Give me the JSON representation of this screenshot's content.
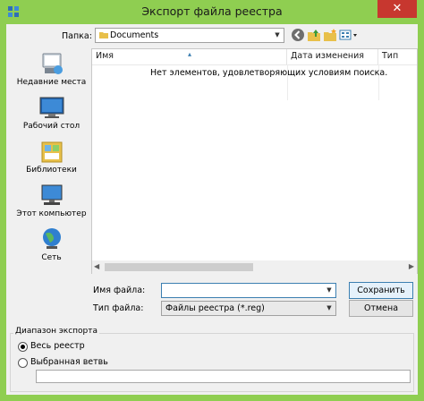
{
  "window": {
    "title": "Экспорт файла реестра",
    "close_glyph": "✕",
    "accent_color": "#8fce51"
  },
  "lookin": {
    "label": "Папка:",
    "value": "Documents"
  },
  "toolbar": {
    "icons": [
      "back-icon",
      "up-folder-icon",
      "new-folder-icon",
      "view-menu-icon"
    ]
  },
  "places": [
    {
      "label": "Недавние места",
      "icon": "recent-places-icon"
    },
    {
      "label": "Рабочий стол",
      "icon": "desktop-icon"
    },
    {
      "label": "Библиотеки",
      "icon": "libraries-icon"
    },
    {
      "label": "Этот компьютер",
      "icon": "computer-icon"
    },
    {
      "label": "Сеть",
      "icon": "network-icon"
    }
  ],
  "filelist": {
    "columns": [
      "Имя",
      "Дата изменения",
      "Тип"
    ],
    "empty_message": "Нет элементов, удовлетворяющих условиям поиска."
  },
  "filename": {
    "label": "Имя файла:",
    "value": ""
  },
  "filetype": {
    "label": "Тип файла:",
    "value": "Файлы реестра (*.reg)"
  },
  "buttons": {
    "save": "Сохранить",
    "cancel": "Отмена"
  },
  "export_range": {
    "title": "Диапазон экспорта",
    "option_all": "Весь реестр",
    "option_branch": "Выбранная ветвь",
    "selected": "all",
    "branch_value": ""
  }
}
